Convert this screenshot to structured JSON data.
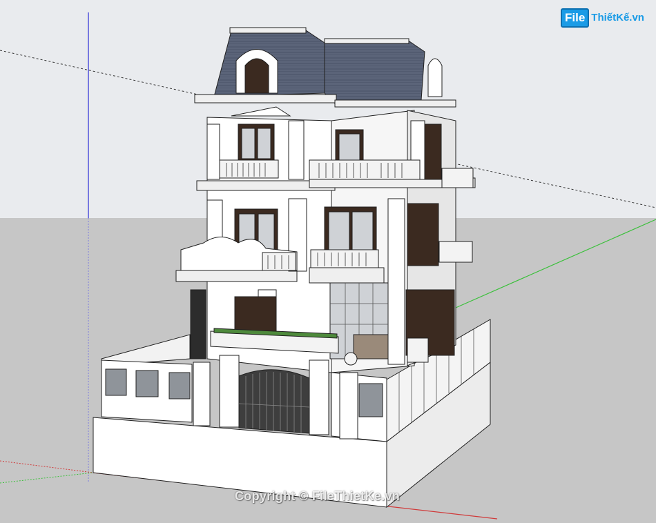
{
  "watermark": {
    "logo_file": "File",
    "logo_rest": "ThiếtKế.vn",
    "copyright": "Copyright © FileThietKe.vn"
  },
  "colors": {
    "sky": "#e9ebee",
    "ground": "#c6c6c6",
    "roof": "#5a6379",
    "wall": "#ffffff",
    "trim": "#efefef",
    "line": "#202020",
    "glass": "#9aa0a6",
    "frame": "#3b2a20",
    "axis_red": "#d03a3a",
    "axis_green": "#3bc03b",
    "axis_blue": "#3a3ad8"
  },
  "icons": {
    "model": "villa-3d-model-icon",
    "logo": "filethietke-logo-icon"
  }
}
